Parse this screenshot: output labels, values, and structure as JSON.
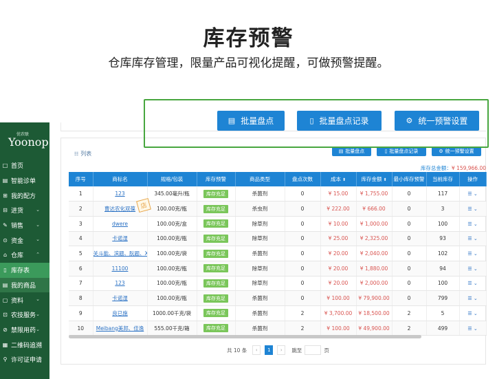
{
  "hero": {
    "title": "库存预警",
    "subtitle": "仓库库存管理，限量产品可视化提醒，可做预警提醒。"
  },
  "logo": {
    "small": "优农联",
    "big": "Yoonop"
  },
  "sidebar": {
    "items": [
      {
        "icon": "monitor-icon",
        "glyph": "□",
        "label": "首页",
        "chev": ""
      },
      {
        "icon": "prescription-icon",
        "glyph": "▤",
        "label": "智能诊单",
        "chev": ""
      },
      {
        "icon": "formula-icon",
        "glyph": "⊞",
        "label": "我的配方",
        "chev": ""
      },
      {
        "icon": "cart-icon",
        "glyph": "⊟",
        "label": "进货",
        "chev": "⌄"
      },
      {
        "icon": "sales-icon",
        "glyph": "✎",
        "label": "销售",
        "chev": "⌄"
      },
      {
        "icon": "money-icon",
        "glyph": "⊙",
        "label": "资金",
        "chev": "⌄"
      },
      {
        "icon": "warehouse-icon",
        "glyph": "⌂",
        "label": "仓库",
        "chev": "⌃"
      },
      {
        "icon": "inventory-icon",
        "glyph": "▯",
        "label": "库存表",
        "chev": ""
      },
      {
        "icon": "goods-icon",
        "glyph": "▤",
        "label": "我的商品",
        "chev": ""
      },
      {
        "icon": "data-icon",
        "glyph": "▢",
        "label": "资料",
        "chev": "⌄"
      },
      {
        "icon": "service-icon",
        "glyph": "⊡",
        "label": "农技服务",
        "chev": "⌄"
      },
      {
        "icon": "pesticide-icon",
        "glyph": "⊘",
        "label": "禁限用药",
        "chev": "⌄"
      },
      {
        "icon": "qrcode-icon",
        "glyph": "▦",
        "label": "二维码追溯",
        "chev": ""
      },
      {
        "icon": "license-icon",
        "glyph": "⚲",
        "label": "许可证申请",
        "chev": ""
      }
    ]
  },
  "big_buttons": {
    "inventory": "批量盘点",
    "records": "批量盘点记录",
    "settings": "统一预警设置"
  },
  "small_buttons": {
    "inventory": "批量盘点",
    "records": "批量盘点记录",
    "settings": "统一预警设置"
  },
  "list_label": "列表",
  "total": {
    "label": "库存总金额：",
    "amount": "¥ 159,966.00"
  },
  "table": {
    "headers": [
      "序号",
      "商标名",
      "规格/包装",
      "库存预警",
      "商品类型",
      "盘点次数",
      "成本",
      "库存金额",
      "最小库存预警",
      "当前库存",
      "操作"
    ],
    "rows": [
      [
        "1",
        "123",
        "345.00毫升/瓶",
        "库存充足",
        "杀菌剂",
        "0",
        "¥ 15.00",
        "¥ 1,755.00",
        "0",
        "117"
      ],
      [
        "2",
        "曹达农化双葆",
        "100.00克/瓶",
        "库存充足",
        "杀虫剂",
        "0",
        "¥ 222.00",
        "¥ 666.00",
        "0",
        "3"
      ],
      [
        "3",
        "dwere",
        "100.00克/盒",
        "库存充足",
        "除草剂",
        "0",
        "¥ 10.00",
        "¥ 1,000.00",
        "0",
        "100"
      ],
      [
        "4",
        "卡诺湿",
        "100.00克/瓶",
        "库存充足",
        "除草剂",
        "0",
        "¥ 25.00",
        "¥ 2,325.00",
        "0",
        "93"
      ],
      [
        "5",
        "关斗能、滨题、朊题、X",
        "100.00克/袋",
        "库存充足",
        "杀菌剂",
        "0",
        "¥ 20.00",
        "¥ 2,040.00",
        "0",
        "102"
      ],
      [
        "6",
        "11100",
        "100.00克/瓶",
        "库存充足",
        "除草剂",
        "0",
        "¥ 20.00",
        "¥ 1,880.00",
        "0",
        "94"
      ],
      [
        "7",
        "123",
        "100.00克/瓶",
        "库存充足",
        "除草剂",
        "0",
        "¥ 20.00",
        "¥ 2,000.00",
        "0",
        "100"
      ],
      [
        "8",
        "卡诺湿",
        "100.00克/瓶",
        "库存充足",
        "杀菌剂",
        "0",
        "¥ 100.00",
        "¥ 79,900.00",
        "0",
        "799"
      ],
      [
        "9",
        "良已施",
        "1000.00千克/袋",
        "库存充足",
        "杀菌剂",
        "2",
        "¥ 3,700.00",
        "¥ 18,500.00",
        "2",
        "5"
      ],
      [
        "10",
        "Meibang美邦、佳逸",
        "555.00千克/箱",
        "库存充足",
        "杀菌剂",
        "2",
        "¥ 100.00",
        "¥ 49,900.00",
        "2",
        "499"
      ]
    ],
    "op_label": "☰ ⌄",
    "stamp": "店"
  },
  "pager": {
    "total_text": "共 10 条",
    "prev": "‹",
    "current": "1",
    "next": "›",
    "goto": "跳至",
    "page_unit": "页"
  }
}
